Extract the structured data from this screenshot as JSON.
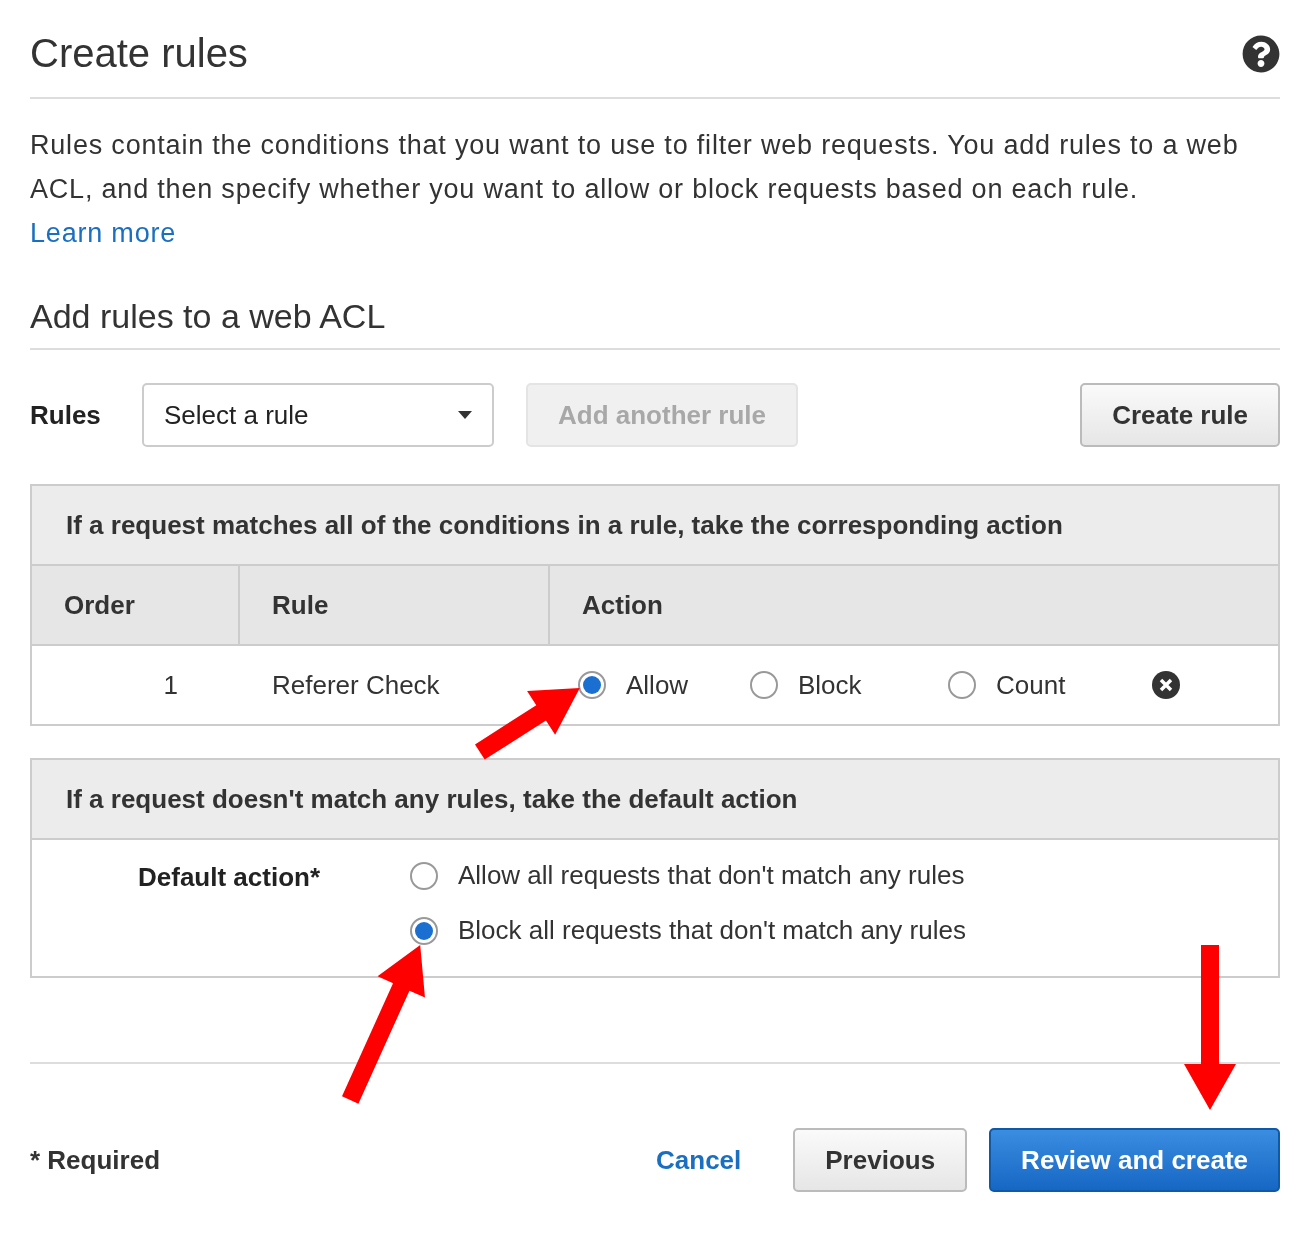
{
  "header": {
    "title": "Create rules"
  },
  "intro": {
    "text": "Rules contain the conditions that you want to use to filter web requests. You add rules to a web ACL, and then specify whether you want to allow or block requests based on each rule.",
    "link": "Learn more"
  },
  "section_title": "Add rules to a web ACL",
  "rules_bar": {
    "label": "Rules",
    "select": {
      "value": "Select a rule"
    },
    "buttons": [
      {
        "label": "Add another rule",
        "disabled": true
      },
      {
        "label": "Create rule",
        "disabled": false
      }
    ]
  },
  "rules_table": {
    "caption": "If a request matches all of the conditions in a rule, take the corresponding action",
    "columns": [
      "Order",
      "Rule",
      "Action"
    ],
    "rows": [
      {
        "order": "1",
        "rule": "Referer Check",
        "actions": [
          {
            "label": "Allow",
            "selected": true
          },
          {
            "label": "Block",
            "selected": false
          },
          {
            "label": "Count",
            "selected": false
          }
        ]
      }
    ]
  },
  "default_panel": {
    "caption": "If a request doesn't match any rules, take the default action",
    "label": "Default action*",
    "options": [
      {
        "label": "Allow all requests that don't match any rules",
        "selected": false
      },
      {
        "label": "Block all requests that don't match any rules",
        "selected": true
      }
    ]
  },
  "footer": {
    "required": "* Required",
    "cancel": "Cancel",
    "buttons": [
      {
        "label": "Previous",
        "kind": "secondary"
      },
      {
        "label": "Review and create",
        "kind": "primary"
      }
    ]
  }
}
